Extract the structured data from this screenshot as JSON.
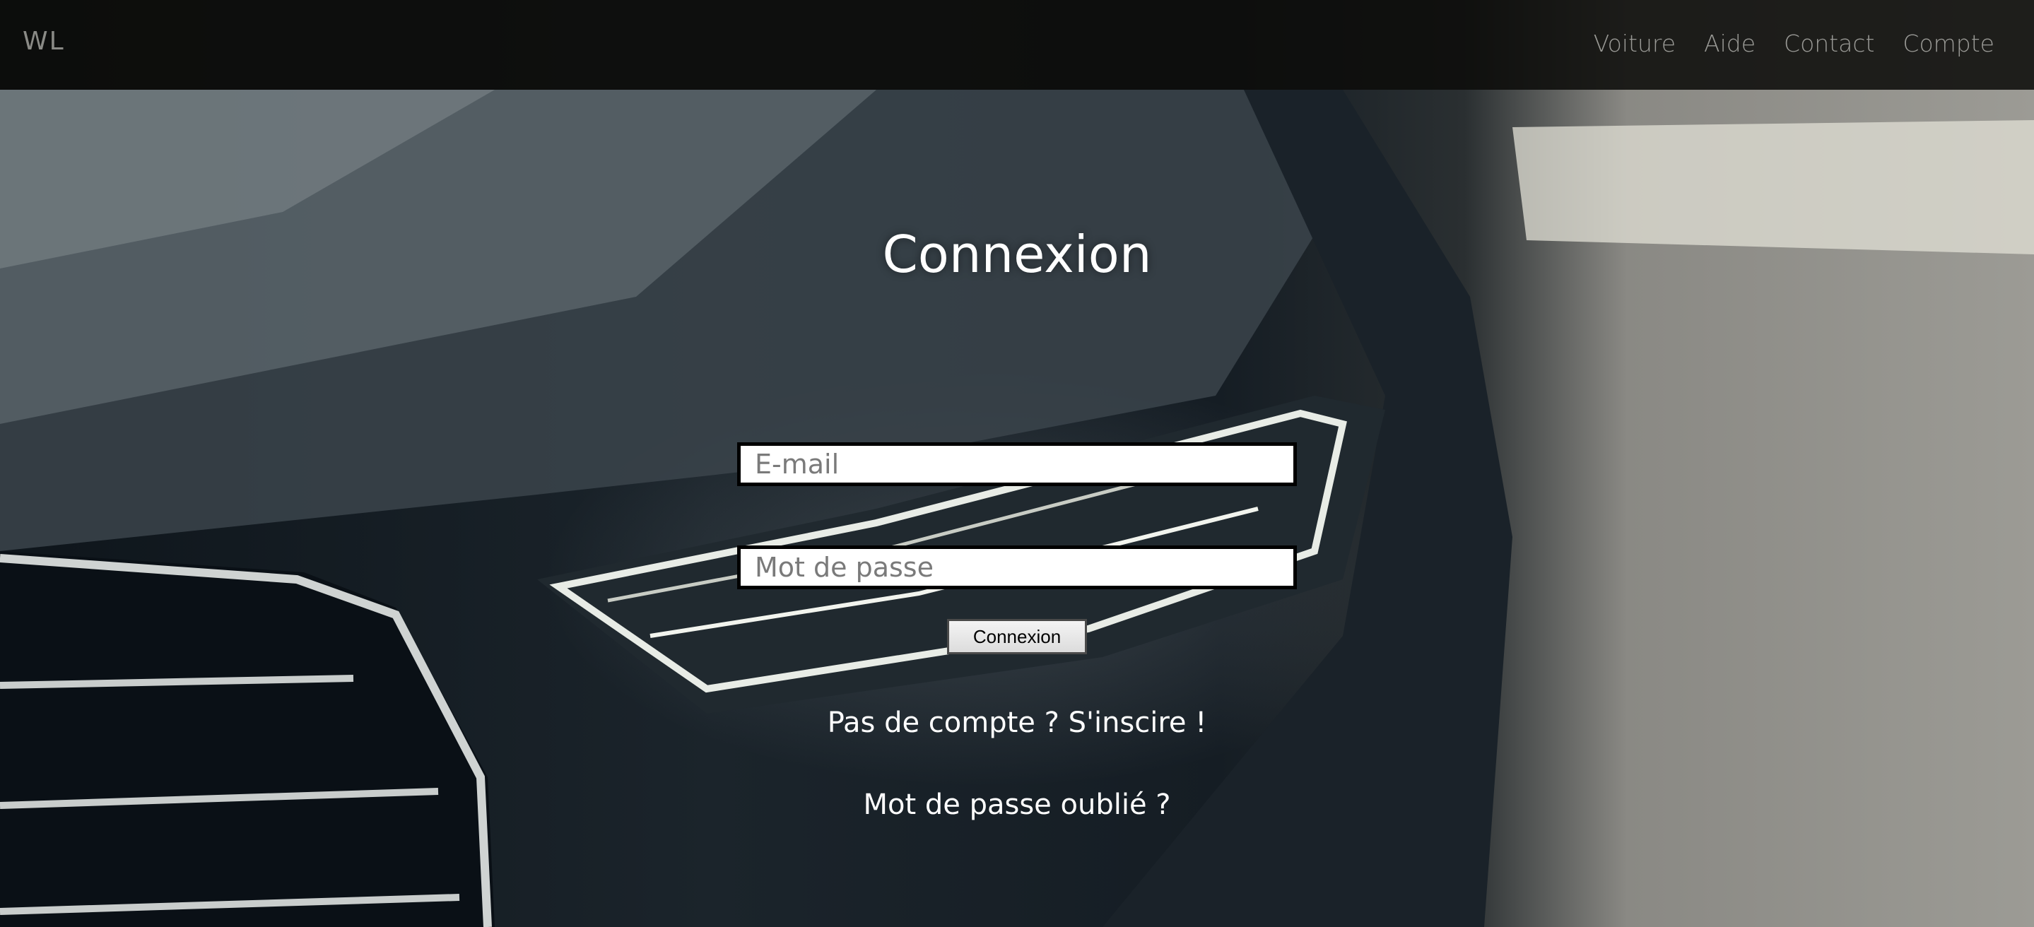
{
  "navbar": {
    "logo": "WL",
    "links": [
      "Voiture",
      "Aide",
      "Contact",
      "Compte"
    ]
  },
  "login": {
    "title": "Connexion",
    "email_placeholder": "E-mail",
    "password_placeholder": "Mot de passe",
    "submit_label": "Connexion",
    "signup_link": "Pas de compte ? S'inscire !",
    "forgot_link": "Mot de passe oublié ?"
  },
  "colors": {
    "navbar_bg": "#0c0c0a",
    "nav_text": "#9a9a96",
    "title_text": "#ffffff",
    "field_border": "#000000"
  },
  "background": {
    "icon": "car-headlight-photo"
  }
}
